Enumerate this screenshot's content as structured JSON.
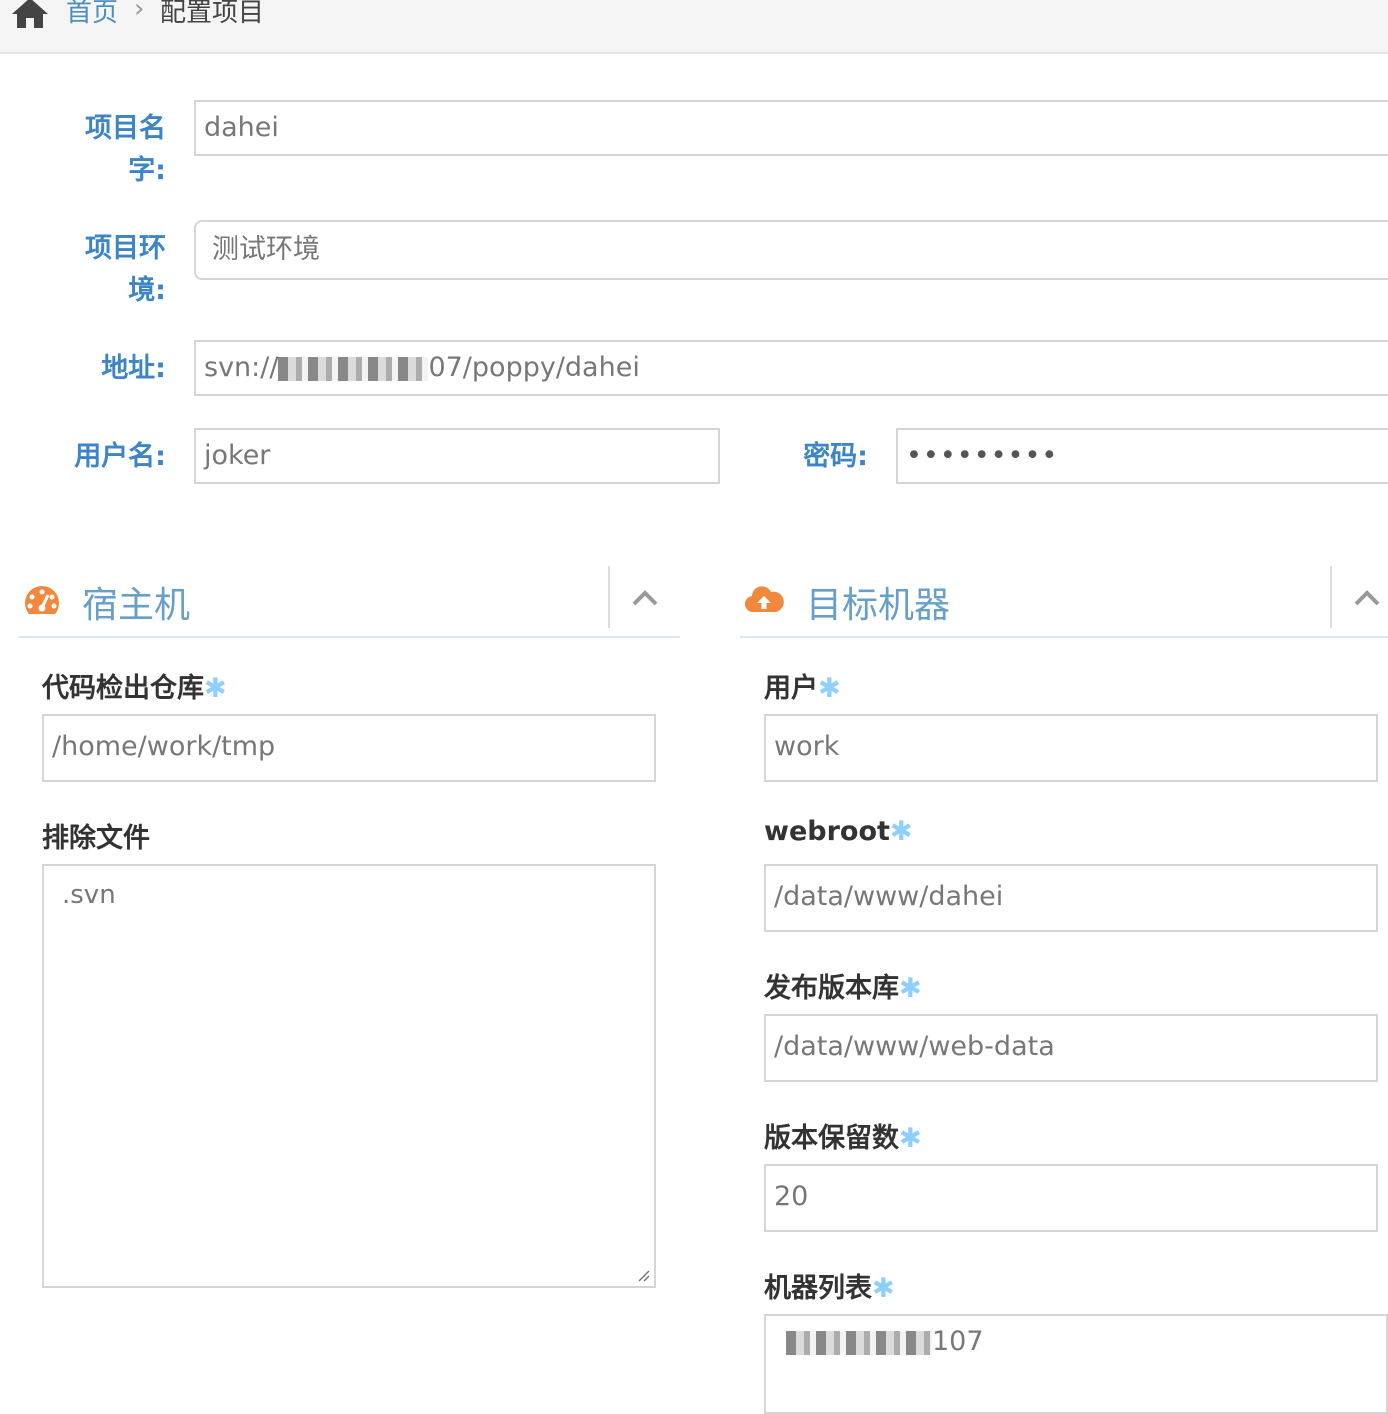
{
  "breadcrumb": {
    "home_icon": "home-icon",
    "home_label": "首页",
    "separator": "›",
    "current": "配置项目"
  },
  "project": {
    "name_label": "项目名字:",
    "name_value": "dahei",
    "env_label": "项目环境:",
    "env_value": "测试环境",
    "url_label": "地址:",
    "url_prefix": "svn://",
    "url_suffix": "07/poppy/dahei",
    "user_label": "用户名:",
    "user_value": "joker",
    "password_label": "密码:",
    "password_value": "•••••••••"
  },
  "host": {
    "title": "宿主机",
    "icon": "dashboard-icon",
    "checkout_label": "代码检出仓库",
    "checkout_value": "/home/work/tmp",
    "exclude_label": "排除文件",
    "exclude_value": ".svn",
    "required_mark": "✱"
  },
  "target": {
    "title": "目标机器",
    "icon": "cloud-upload-icon",
    "user_label": "用户",
    "user_value": "work",
    "webroot_label": "webroot",
    "webroot_value": "/data/www/dahei",
    "release_label": "发布版本库",
    "release_value": "/data/www/web-data",
    "keep_label": "版本保留数",
    "keep_value": "20",
    "hosts_label": "机器列表",
    "hosts_value_suffix": "107",
    "required_mark": "✱"
  },
  "colors": {
    "label_blue": "#3d85c6",
    "widget_title": "#669fc7",
    "icon_orange": "#f0883e",
    "required_star": "#8ecfff"
  }
}
